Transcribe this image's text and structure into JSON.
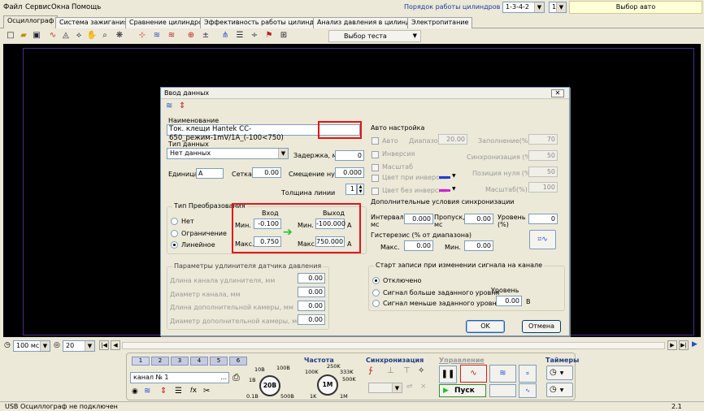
{
  "menu": [
    "Файл",
    "Сервис",
    "Окна",
    "Помощь"
  ],
  "cylinders": {
    "label": "Порядок работы цилиндров",
    "order": "1-3-4-2",
    "count": "1",
    "auto_label": "Выбор авто"
  },
  "tabs": [
    "Осциллограф",
    "Система зажигания",
    "Сравнение цилиндров",
    "Эффективность работы цилиндров",
    "Анализ давления в цилиндре",
    "Электропитание"
  ],
  "toolbar": {
    "test_select": "Выбор теста"
  },
  "dialog": {
    "title": "Ввод данных",
    "name_label": "Наименование",
    "name_value": "Ток. клещи Hantek CC-650_режим-1mV/1A_(-100<750)",
    "data_type_label": "Тип данных",
    "data_type_value": "Нет данных",
    "delay_label": "Задержка, мс",
    "delay_value": "0",
    "unit_label": "Единица",
    "unit_value": "A",
    "grid_label": "Сетка",
    "grid_value": "0.00",
    "offset_label": "Смещение нуля",
    "offset_value": "0.000",
    "line_label": "Толщина линии",
    "line_value": "1",
    "conv": {
      "title": "Тип Преобразования",
      "options": [
        "Нет",
        "Ограничение",
        "Линейное"
      ],
      "input_label": "Вход",
      "output_label": "Выход",
      "min_label": "Мин.",
      "max_label": "Макс.",
      "in_min": "-0.100",
      "in_max": "0.750",
      "out_min": "-100.000",
      "out_max": "750.000",
      "unit": "A"
    },
    "ext": {
      "title": "Параметры удлинителя датчика давления",
      "rows": [
        {
          "label": "Длина канала удлинителя, мм",
          "value": "0.00"
        },
        {
          "label": "Диаметр канала, мм",
          "value": "0.00"
        },
        {
          "label": "Длина дополнительной камеры, мм",
          "value": "0.00"
        },
        {
          "label": "Диаметр дополнительной камеры, мм",
          "value": "0.00"
        }
      ]
    },
    "auto": {
      "title": "Авто настройка",
      "auto": "Авто",
      "range_label": "Диапазон",
      "range_value": "20.00",
      "fill_label": "Заполнение(%)",
      "fill_value": "70",
      "invert": "Инверсия",
      "sync_label": "Синхронизация (%)",
      "sync_value": "50",
      "scale": "Масштаб",
      "zero_label": "Позиция нуля (%)",
      "zero_value": "50",
      "color_inv": "Цвет при инверсии",
      "color_noinv": "Цвет без инверсии",
      "scale_label": "Масштаб(%)",
      "scale_value": "100"
    },
    "sync": {
      "title": "Дополнительные условия синхронизации",
      "interval_label": "Интервал, мс",
      "interval_value": "0.000",
      "skip_label": "Пропуск, мс",
      "skip_value": "0.00",
      "level_label": "Уровень (%)",
      "level_value": "0",
      "hyst_label": "Гистерезис (% от диапазона)",
      "max_label": "Макс.",
      "max_value": "0.00",
      "min_label": "Мин.",
      "min_value": "0.00"
    },
    "record": {
      "title": "Старт записи при изменении сигнала на канале",
      "options": [
        "Отключено",
        "Сигнал больше заданного уровня",
        "Сигнал меньше заданного уровня"
      ],
      "level_label": "Уровень",
      "level_value": "0.00",
      "level_unit": "В"
    },
    "ok": "OK",
    "cancel": "Отмена"
  },
  "bottom": {
    "time": "100 мс",
    "count": "20"
  },
  "panel": {
    "channels": [
      "1",
      "2",
      "3",
      "4",
      "5",
      "6"
    ],
    "channel_name": "канал № 1",
    "voltage": {
      "center": "20В",
      "labels": [
        "10В",
        "100В",
        "1В",
        "0.1В",
        "500В"
      ]
    },
    "freq": {
      "title": "Частота",
      "center": "1М",
      "labels": [
        "250K",
        "100K",
        "333K",
        "500K",
        "1K",
        "1M"
      ]
    },
    "sync_title": "Синхронизация",
    "control_title": "Управление",
    "start": "Пуск",
    "timers_title": "Таймеры"
  },
  "status": {
    "left": "USB Осциллограф не подключен",
    "right": "2.1"
  },
  "colors": {
    "accent_red": "#e5131a",
    "inverse_blue": "#1f3fd0",
    "noinverse_magenta": "#d020d0",
    "arrow_green": "#22c22a"
  }
}
